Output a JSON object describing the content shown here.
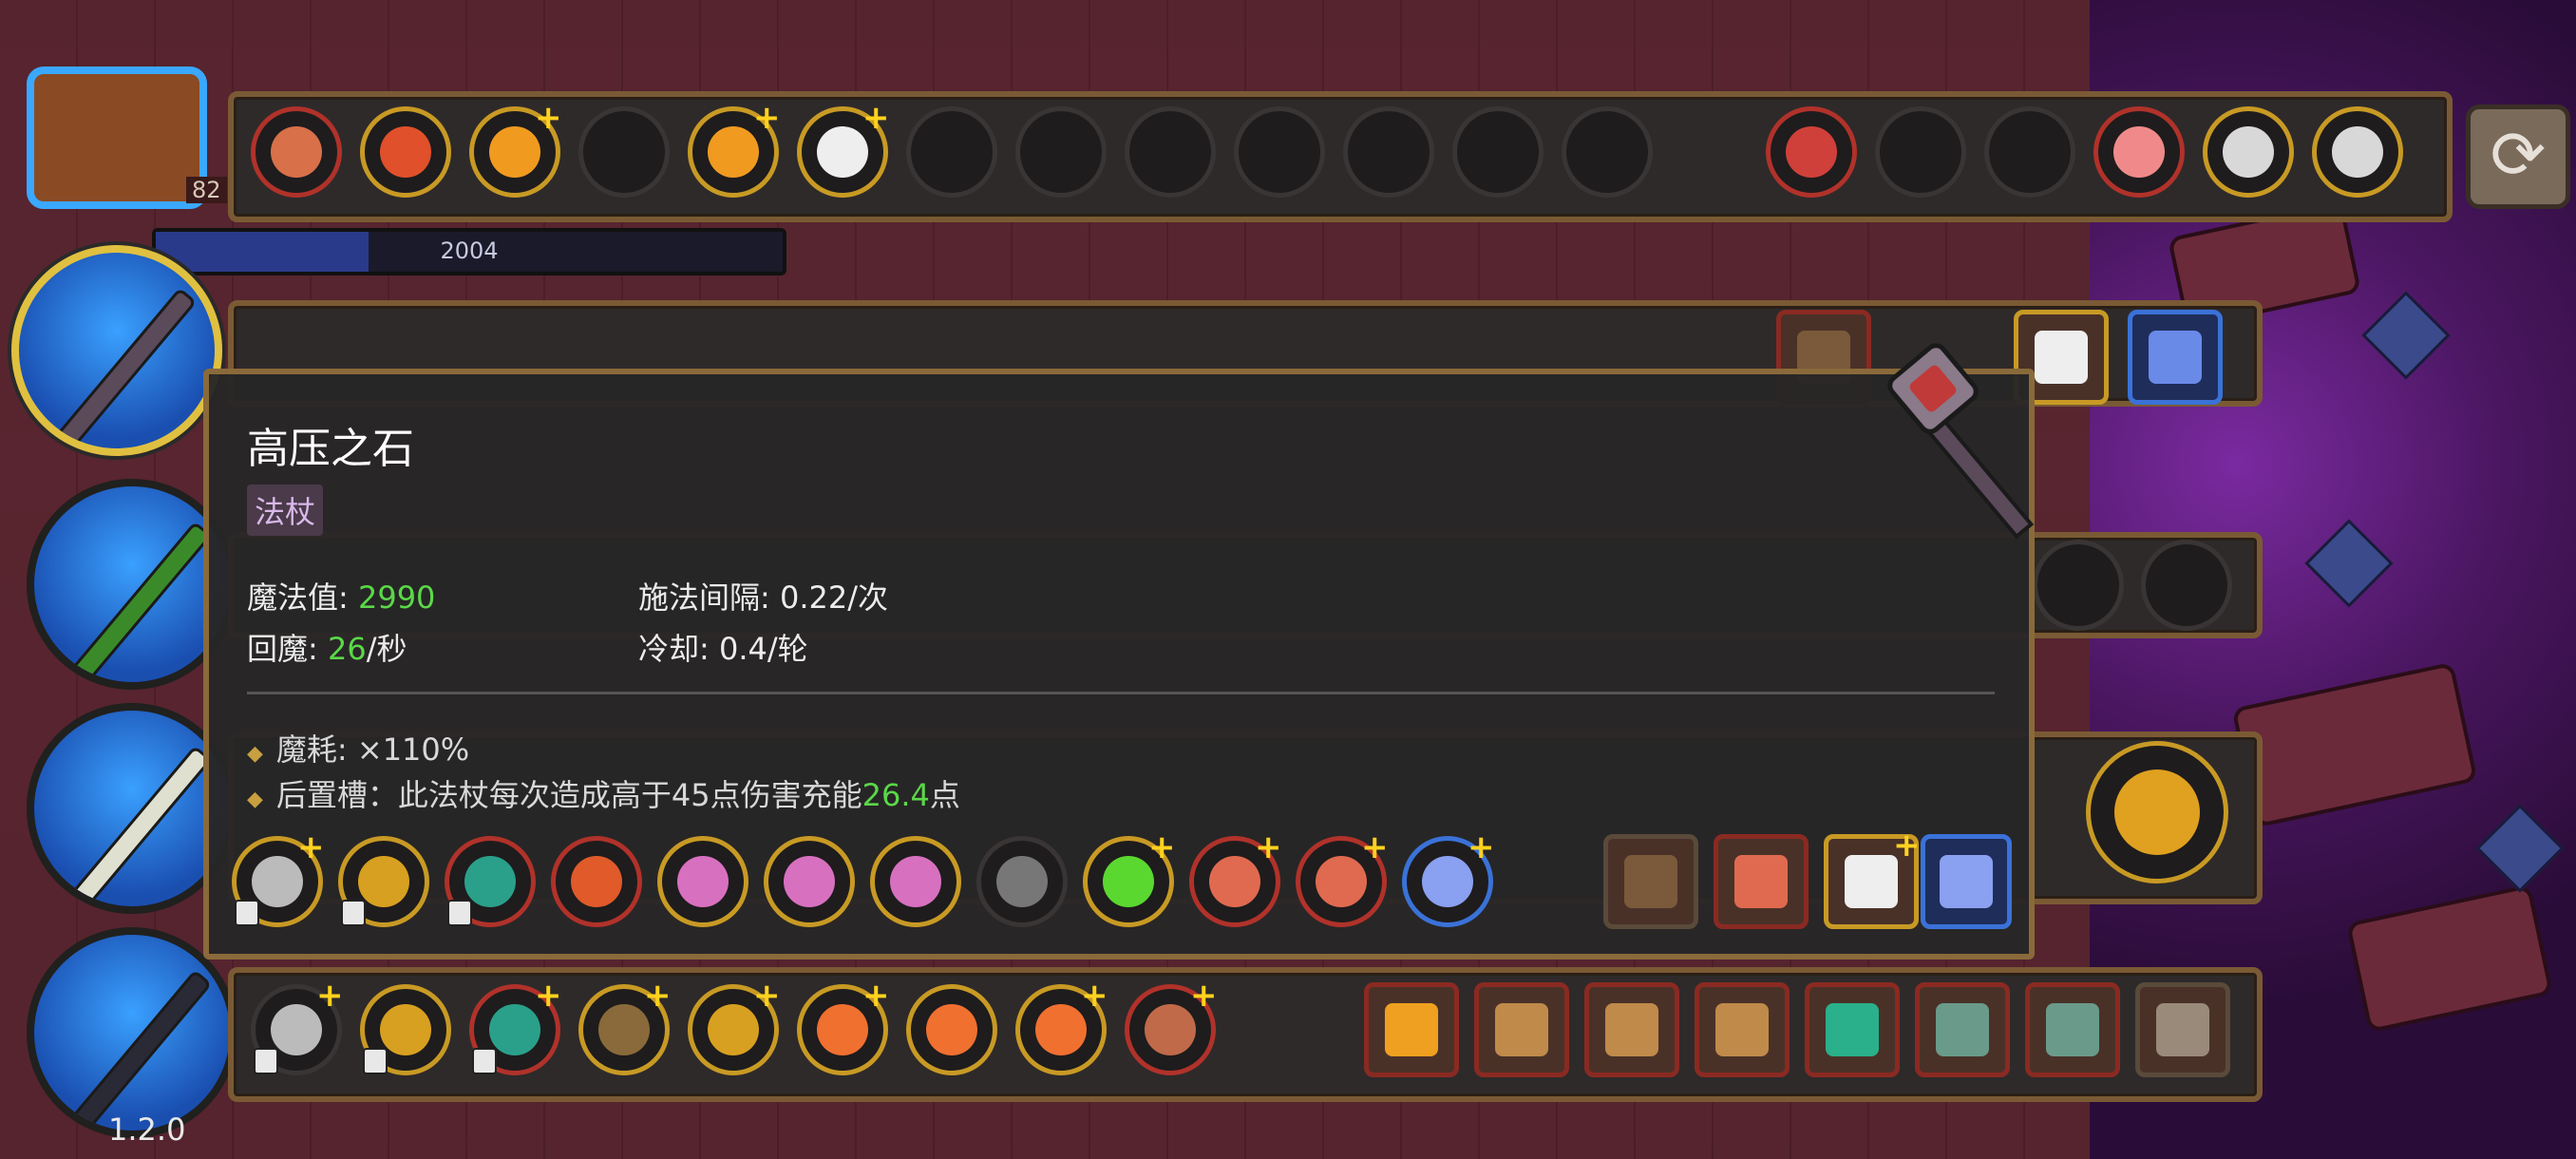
{
  "counters": {
    "bag_count": "82",
    "mana_value": "2004",
    "mana_fraction": 0.34
  },
  "version": "1.2.0",
  "tooltip": {
    "title": "高压之石",
    "type_label": "法杖",
    "mana_label": "魔法值: ",
    "mana_value": "2990",
    "regen_label": "回魔: ",
    "regen_value": "26",
    "regen_unit": "/秒",
    "interval": "施法间隔: 0.22/次",
    "cooldown": "冷却: 0.4/轮",
    "bullet1": "魔耗: ×110%",
    "bullet2_prefix": "后置槽：此法杖每次造成高于45点伤害充能",
    "bullet2_value": "26.4",
    "bullet2_suffix": "点"
  },
  "icons": {
    "bag": "bag-icon",
    "refresh": "refresh-icon",
    "wand": "wand-icon"
  },
  "colors": {
    "gold": "#c89a24",
    "red": "#b0322a",
    "blue": "#3a72d8",
    "green_text": "#5ad848"
  }
}
